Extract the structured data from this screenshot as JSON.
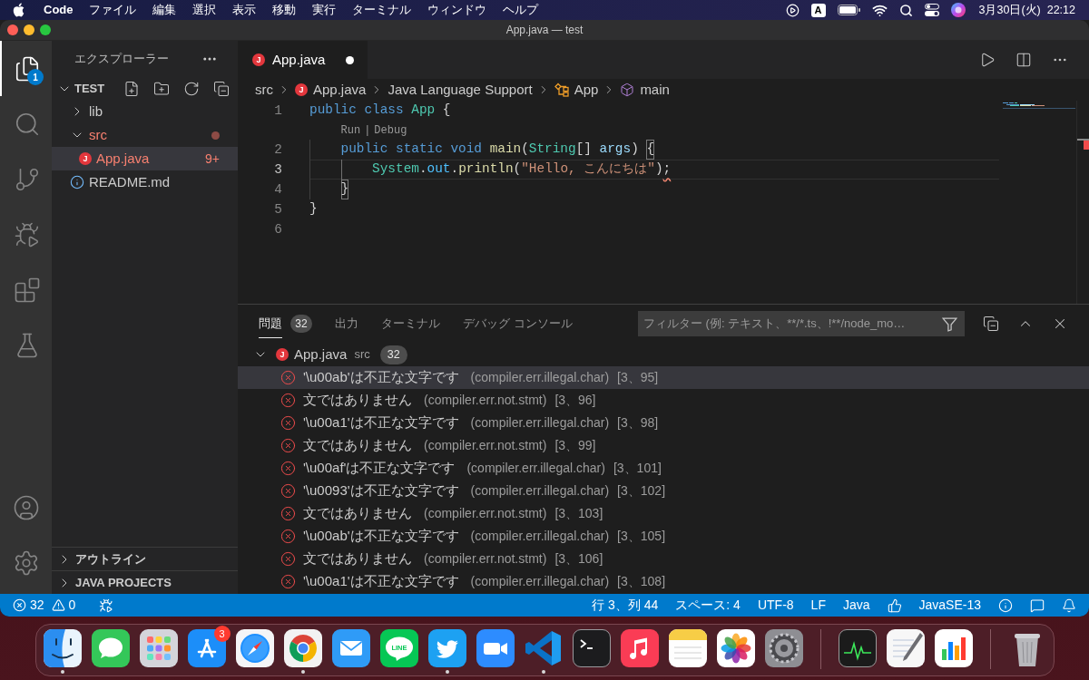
{
  "menu_bar": {
    "app_name": "Code",
    "menus": [
      "ファイル",
      "編集",
      "選択",
      "表示",
      "移動",
      "実行",
      "ターミナル",
      "ウィンドウ",
      "ヘルプ"
    ],
    "input_source": "A",
    "date": "3月30日(火)",
    "time": "22:12"
  },
  "window": {
    "title": "App.java — test"
  },
  "activity_bar": {
    "items": [
      {
        "kind": "explorer",
        "selected": true,
        "badge": "1"
      },
      {
        "kind": "search",
        "selected": false
      },
      {
        "kind": "scm",
        "selected": false
      },
      {
        "kind": "debug",
        "selected": false
      },
      {
        "kind": "extensions",
        "selected": false
      },
      {
        "kind": "testing",
        "selected": false
      }
    ],
    "bottom": [
      {
        "kind": "account"
      },
      {
        "kind": "settings"
      }
    ]
  },
  "sidebar": {
    "title": "エクスプローラー",
    "workspace": {
      "label": "TEST",
      "expanded": true
    },
    "tree": [
      {
        "name": "lib",
        "kind": "folder",
        "expanded": false,
        "selected": false,
        "problem": false
      },
      {
        "name": "src",
        "kind": "folder",
        "expanded": true,
        "selected": false,
        "problem": true,
        "children": [
          {
            "name": "App.java",
            "kind": "java",
            "icon_letter": "J",
            "selected": true,
            "problem": true,
            "badge": "9+"
          }
        ]
      },
      {
        "name": "README.md",
        "kind": "info",
        "selected": false,
        "problem": false
      }
    ],
    "sections": [
      {
        "label": "アウトライン",
        "expanded": false
      },
      {
        "label": "JAVA PROJECTS",
        "expanded": false
      }
    ]
  },
  "editor": {
    "tabs": [
      {
        "label": "App.java",
        "icon_letter": "J",
        "selected": true,
        "dirty": true
      }
    ],
    "breadcrumbs": [
      {
        "label": "src",
        "kind": "folder"
      },
      {
        "label": "App.java",
        "kind": "java",
        "icon_letter": "J"
      },
      {
        "label": "Java Language Support",
        "kind": "plain"
      },
      {
        "label": "App",
        "kind": "class"
      },
      {
        "label": "main",
        "kind": "method"
      }
    ],
    "lines": [
      {
        "number": "1",
        "current": false,
        "tokens": [
          {
            "text": "public ",
            "kind": "keyword"
          },
          {
            "text": "class ",
            "kind": "keyword"
          },
          {
            "text": "App",
            "kind": "type"
          },
          {
            "text": " {",
            "kind": "plain"
          }
        ]
      },
      {
        "number": "2",
        "current": false,
        "codelens": {
          "actions": [
            "Run",
            "Debug"
          ],
          "separator": "|"
        },
        "tokens": [
          {
            "text": "    public static void ",
            "kind": "keyword"
          },
          {
            "text": "main",
            "kind": "function"
          },
          {
            "text": "(",
            "kind": "plain"
          },
          {
            "text": "String",
            "kind": "type"
          },
          {
            "text": "[] ",
            "kind": "plain"
          },
          {
            "text": "args",
            "kind": "variable"
          },
          {
            "text": ") ",
            "kind": "plain"
          },
          {
            "text": "{",
            "kind": "bracket"
          }
        ]
      },
      {
        "number": "3",
        "current": true,
        "tokens": [
          {
            "text": "        System",
            "kind": "type"
          },
          {
            "text": ".",
            "kind": "plain"
          },
          {
            "text": "out",
            "kind": "field"
          },
          {
            "text": ".",
            "kind": "plain"
          },
          {
            "text": "println",
            "kind": "function"
          },
          {
            "text": "(",
            "kind": "plain"
          },
          {
            "text": "\"Hello, こんにちは\"",
            "kind": "string"
          },
          {
            "text": ")",
            "kind": "plain"
          },
          {
            "text": ";",
            "kind": "error"
          }
        ]
      },
      {
        "number": "4",
        "current": false,
        "tokens": [
          {
            "text": "    }",
            "kind": "bracket"
          }
        ]
      },
      {
        "number": "5",
        "current": false,
        "tokens": [
          {
            "text": "}",
            "kind": "plain"
          }
        ]
      },
      {
        "number": "6",
        "current": false
      }
    ]
  },
  "panel": {
    "tabs": [
      {
        "label": "問題",
        "selected": true,
        "badge": "32"
      },
      {
        "label": "出力",
        "selected": false
      },
      {
        "label": "ターミナル",
        "selected": false
      },
      {
        "label": "デバッグ コンソール",
        "selected": false
      }
    ],
    "filter": {
      "placeholder": "フィルター (例: テキスト、**/*.ts、!**/node_mo…"
    },
    "problems": {
      "file": "App.java",
      "icon_letter": "J",
      "folder": "src",
      "count": "32",
      "expanded": true,
      "items": [
        {
          "kind": "error",
          "message": "'\\u00ab'は不正な文字です",
          "code": "(compiler.err.illegal.char)",
          "position": "[3、95]",
          "selected": true
        },
        {
          "kind": "error",
          "message": "文ではありません",
          "code": "(compiler.err.not.stmt)",
          "position": "[3、96]",
          "selected": false
        },
        {
          "kind": "error",
          "message": "'\\u00a1'は不正な文字です",
          "code": "(compiler.err.illegal.char)",
          "position": "[3、98]",
          "selected": false
        },
        {
          "kind": "error",
          "message": "文ではありません",
          "code": "(compiler.err.not.stmt)",
          "position": "[3、99]",
          "selected": false
        },
        {
          "kind": "error",
          "message": "'\\u00af'は不正な文字です",
          "code": "(compiler.err.illegal.char)",
          "position": "[3、101]",
          "selected": false
        },
        {
          "kind": "error",
          "message": "'\\u0093'は不正な文字です",
          "code": "(compiler.err.illegal.char)",
          "position": "[3、102]",
          "selected": false
        },
        {
          "kind": "error",
          "message": "文ではありません",
          "code": "(compiler.err.not.stmt)",
          "position": "[3、103]",
          "selected": false
        },
        {
          "kind": "error",
          "message": "'\\u00ab'は不正な文字です",
          "code": "(compiler.err.illegal.char)",
          "position": "[3、105]",
          "selected": false
        },
        {
          "kind": "error",
          "message": "文ではありません",
          "code": "(compiler.err.not.stmt)",
          "position": "[3、106]",
          "selected": false
        },
        {
          "kind": "error",
          "message": "'\\u00a1'は不正な文字です",
          "code": "(compiler.err.illegal.char)",
          "position": "[3、108]",
          "selected": false
        }
      ]
    }
  },
  "status_bar": {
    "errors": "32",
    "warnings": "0",
    "right": [
      "行 3、列 44",
      "スペース: 4",
      "UTF-8",
      "LF",
      "Java"
    ],
    "java_version": "JavaSE-13"
  },
  "dock": {
    "sections": [
      {
        "apps": [
          {
            "kind": "face",
            "running": true
          },
          {
            "kind": "chat",
            "running": false
          },
          {
            "kind": "grid",
            "running": false
          },
          {
            "kind": "store",
            "running": false,
            "badge": "3"
          },
          {
            "kind": "compass",
            "running": false
          },
          {
            "kind": "wheel",
            "running": true
          },
          {
            "kind": "envelope",
            "running": false
          },
          {
            "kind": "speech",
            "running": false,
            "label": "LINE"
          },
          {
            "kind": "bird",
            "running": true
          },
          {
            "kind": "camera",
            "running": false
          },
          {
            "kind": "ribbon",
            "running": true
          },
          {
            "kind": "prompt",
            "running": false
          },
          {
            "kind": "note",
            "running": false
          },
          {
            "kind": "notepad",
            "running": false
          },
          {
            "kind": "flower",
            "running": false
          },
          {
            "kind": "cog",
            "running": false
          }
        ]
      },
      {
        "apps": [
          {
            "kind": "monitor",
            "running": false
          },
          {
            "kind": "pen",
            "running": false
          },
          {
            "kind": "bars",
            "running": false
          }
        ]
      },
      {
        "apps": [
          {
            "kind": "bin",
            "running": false
          }
        ]
      }
    ]
  }
}
